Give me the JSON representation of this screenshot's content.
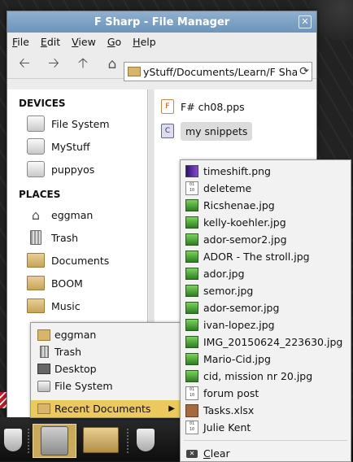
{
  "window": {
    "title": "F Sharp - File Manager",
    "close_glyph": "✕"
  },
  "menu": [
    {
      "first": "F",
      "rest": "ile"
    },
    {
      "first": "E",
      "rest": "dit"
    },
    {
      "first": "V",
      "rest": "iew"
    },
    {
      "first": "G",
      "rest": "o"
    },
    {
      "first": "H",
      "rest": "elp"
    }
  ],
  "path": "yStuff/Documents/Learn/F Sharp/",
  "sidebar": {
    "devices_header": "DEVICES",
    "devices": [
      "File System",
      "MyStuff",
      "puppyos"
    ],
    "places_header": "PLACES",
    "places": [
      "eggman",
      "Trash",
      "Documents",
      "BOOM",
      "Music"
    ]
  },
  "files": [
    "F# ch08.pps",
    "my snippets"
  ],
  "places_menu": {
    "items": [
      "eggman",
      "Trash",
      "Desktop",
      "File System"
    ],
    "recent": "Recent Documents"
  },
  "recent_documents": [
    {
      "name": "timeshift.png",
      "icon": "png-icon"
    },
    {
      "name": "deleteme",
      "icon": "binary-icon"
    },
    {
      "name": "Ricshenae.jpg",
      "icon": "jpg-icon"
    },
    {
      "name": "kelly-koehler.jpg",
      "icon": "jpg-icon"
    },
    {
      "name": "ador-semor2.jpg",
      "icon": "jpg-icon"
    },
    {
      "name": "ADOR - The stroll.jpg",
      "icon": "jpg-icon"
    },
    {
      "name": "ador.jpg",
      "icon": "jpg-icon"
    },
    {
      "name": "semor.jpg",
      "icon": "jpg-icon"
    },
    {
      "name": "ador-semor.jpg",
      "icon": "jpg-icon"
    },
    {
      "name": "ivan-lopez.jpg",
      "icon": "jpg-icon"
    },
    {
      "name": "IMG_20150624_223630.jpg",
      "icon": "jpg-icon"
    },
    {
      "name": "Mario-Cid.jpg",
      "icon": "jpg-icon"
    },
    {
      "name": "cid, mission nr 20.jpg",
      "icon": "jpg-icon"
    },
    {
      "name": "forum post",
      "icon": "binary-icon"
    },
    {
      "name": "Tasks.xlsx",
      "icon": "xlsx-icon"
    },
    {
      "name": "Julie Kent",
      "icon": "binary-icon"
    }
  ],
  "clear": {
    "first": "C",
    "rest": "lear"
  },
  "icons": {
    "pps_letter": "F",
    "c_letter": "C",
    "bin": "01\n10"
  }
}
